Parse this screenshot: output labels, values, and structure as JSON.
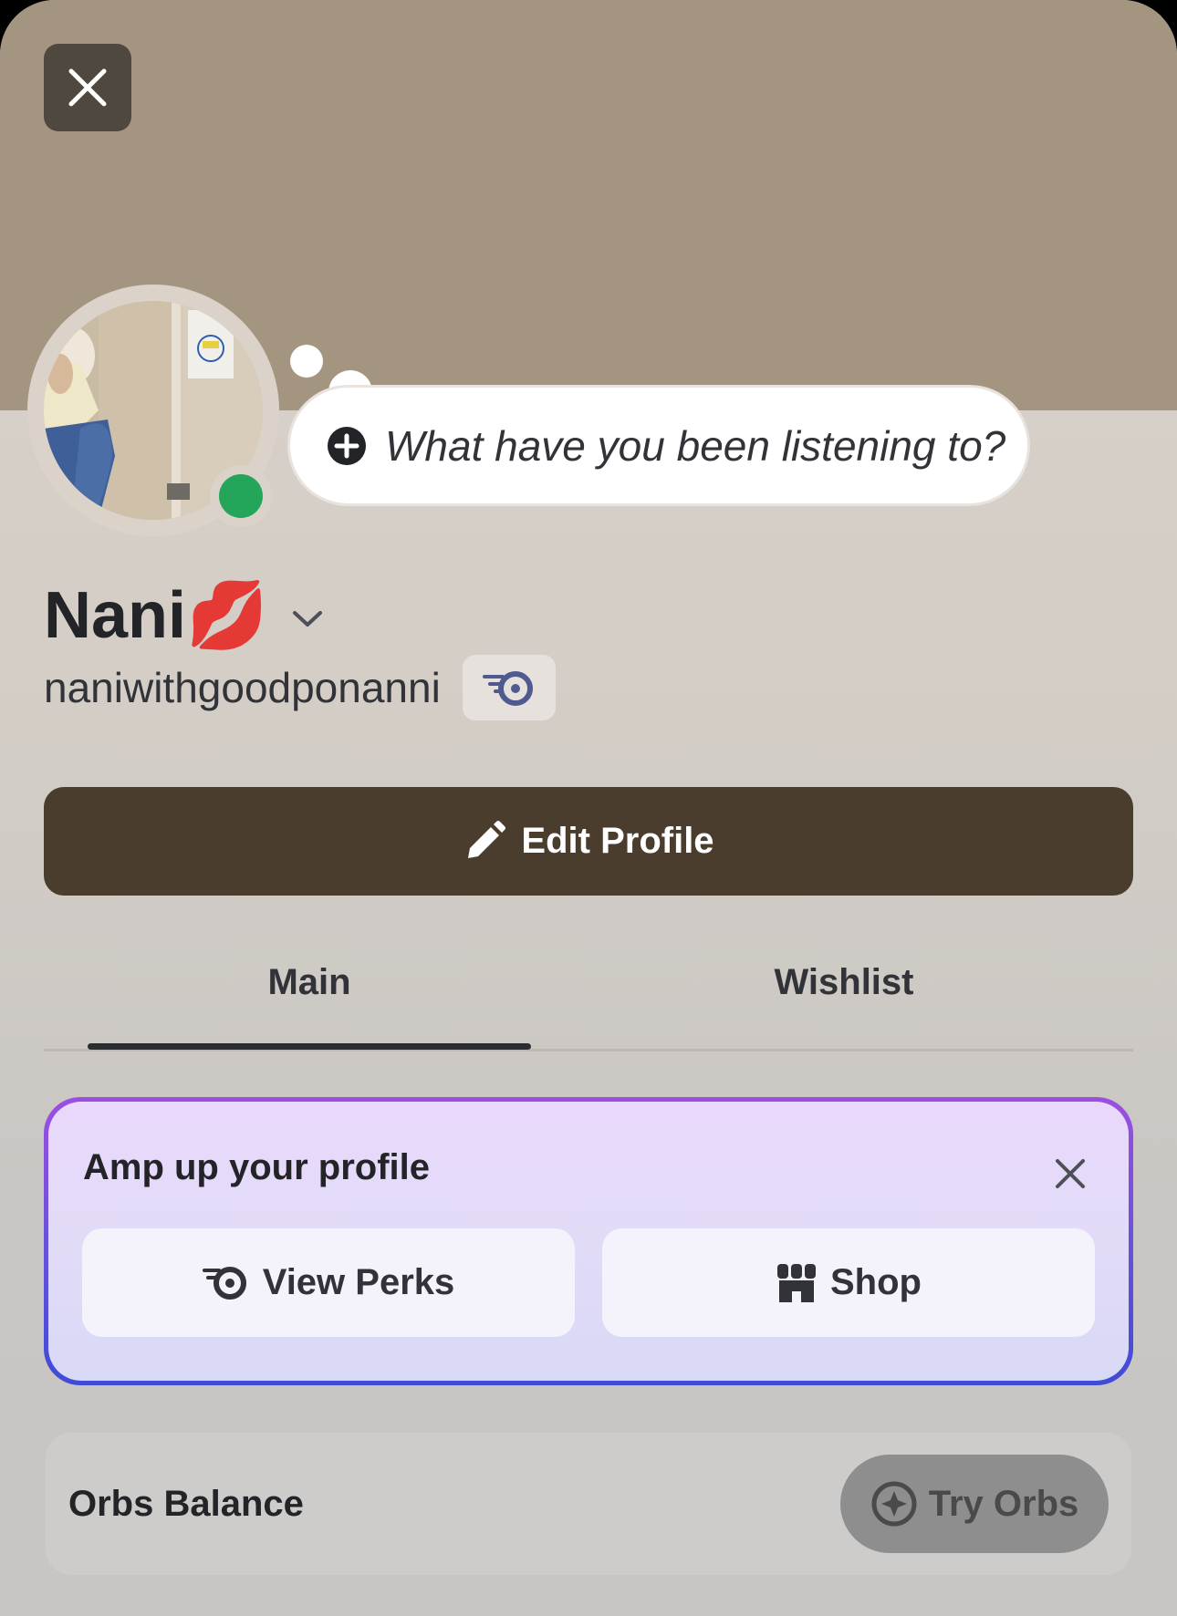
{
  "profile": {
    "display_name": "Nani💋",
    "username": "naniwithgoodponanni",
    "status": "online"
  },
  "status_bubble": {
    "placeholder": "What have you been listening to?"
  },
  "actions": {
    "edit_profile_label": "Edit Profile"
  },
  "tabs": [
    {
      "label": "Main",
      "selected": true
    },
    {
      "label": "Wishlist",
      "selected": false
    }
  ],
  "promo": {
    "title": "Amp up your profile",
    "view_perks_label": "View Perks",
    "shop_label": "Shop"
  },
  "orbs": {
    "title": "Orbs Balance",
    "button_label": "Try Orbs"
  },
  "colors": {
    "banner": "#a49580",
    "edit_button": "#4a3d2d",
    "online": "#23a55a",
    "promo_border_top": "#9b4fe0",
    "promo_border_bottom": "#3f4bd6"
  },
  "icons": {
    "close": "close-icon",
    "add": "plus-circle-icon",
    "chevron": "chevron-down-icon",
    "badge": "nitro-icon",
    "edit": "pencil-icon",
    "perks": "nitro-icon",
    "shop": "shop-icon",
    "orbs": "orb-icon"
  }
}
